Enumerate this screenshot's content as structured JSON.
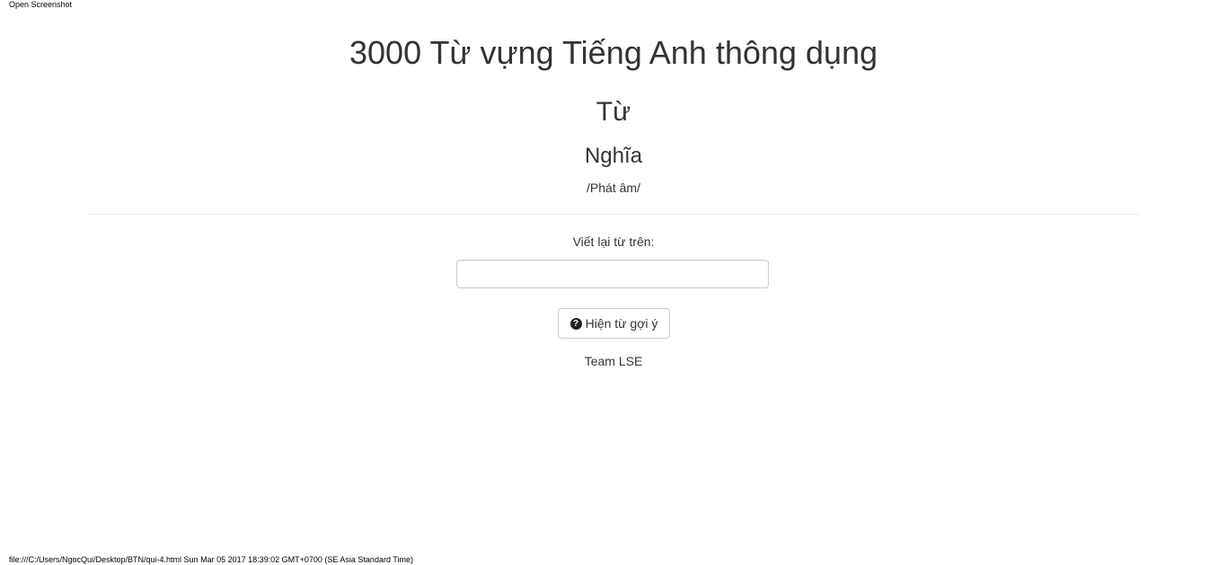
{
  "print": {
    "header": "Open Screenshot",
    "footer": "file:///C:/Users/NgocQui/Desktop/BTN/qui-4.html Sun Mar 05 2017 18:39:02 GMT+0700 (SE Asia Standard Time)"
  },
  "main": {
    "title": "3000 Từ vựng Tiếng Anh thông dụng",
    "word": "Từ",
    "meaning": "Nghĩa",
    "pronunciation": "/Phát âm/",
    "rewrite_label": "Viết lại từ trên:",
    "input_value": "",
    "hint_button_label": "Hiện từ gợi ý",
    "hint_icon": "question-circle-icon",
    "team": "Team LSE"
  }
}
